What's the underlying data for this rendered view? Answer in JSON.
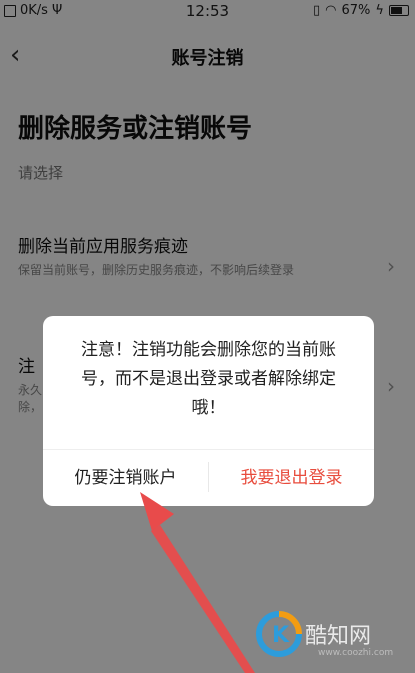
{
  "status_bar": {
    "network_speed": "0K/s",
    "time": "12:53",
    "battery": "67%"
  },
  "nav": {
    "title": "账号注销"
  },
  "page": {
    "heading": "删除服务或注销账号",
    "prompt": "请选择",
    "options": [
      {
        "title": "删除当前应用服务痕迹",
        "desc": "保留当前账号，删除历史服务痕迹，不影响后续登录"
      },
      {
        "title": "注",
        "desc": "永久\n除，"
      }
    ]
  },
  "dialog": {
    "message": "注意！注销功能会删除您的当前账号，而不是退出登录或者解除绑定哦！",
    "cancel_label": "仍要注销账户",
    "confirm_label": "我要退出登录"
  },
  "watermark": {
    "text": "酷知网",
    "url": "www.coozhi.com"
  },
  "colors": {
    "accent": "#e84c3d",
    "arrow": "#e84b4b",
    "overlay": "rgba(0,0,0,0.48)"
  }
}
